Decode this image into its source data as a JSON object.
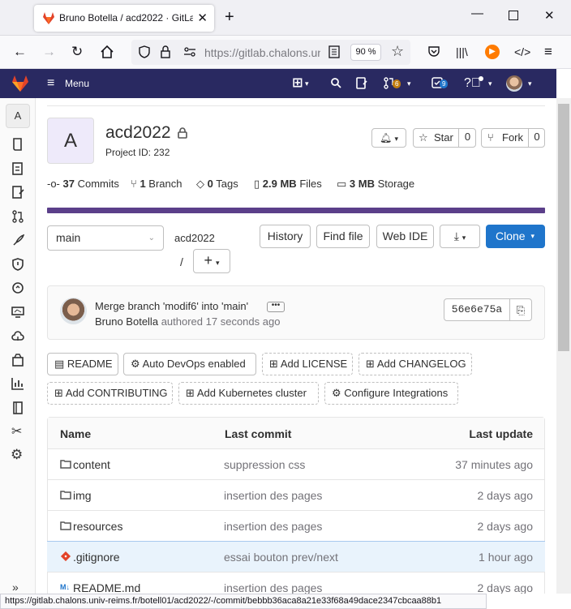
{
  "browser": {
    "tab_title": "Bruno Botella / acd2022 · GitLab",
    "url": "https://gitlab.chalons.univ-reims.fr/botell01/acd2022",
    "zoom": "90 %",
    "status_url": "https://gitlab.chalons.univ-reims.fr/botell01/acd2022/-/commit/bebbb36aca8a21e33f68a49dace2347cbcaa88b1"
  },
  "gitlab_header": {
    "menu_label": "Menu",
    "mr_count": "6",
    "todo_count": "9"
  },
  "sidebar": {
    "project_initial": "A"
  },
  "project": {
    "avatar_letter": "A",
    "name": "acd2022",
    "id_text": "Project ID: 232",
    "star_label": "Star",
    "star_count": "0",
    "fork_label": "Fork",
    "fork_count": "0"
  },
  "stats": {
    "commits_num": "37",
    "commits_label": "Commits",
    "branch_num": "1",
    "branch_label": "Branch",
    "tags_num": "0",
    "tags_label": "Tags",
    "files_num": "2.9 MB",
    "files_label": "Files",
    "storage_num": "3 MB",
    "storage_label": "Storage"
  },
  "repo_nav": {
    "branch": "main",
    "path": "acd2022",
    "separator": "/",
    "history": "History",
    "find_file": "Find file",
    "web_ide": "Web IDE",
    "clone": "Clone"
  },
  "last_commit": {
    "title": "Merge branch 'modif6' into 'main'",
    "author": "Bruno Botella",
    "authored": "authored",
    "time": "17 seconds ago",
    "sha": "56e6e75a"
  },
  "shortcuts": [
    "README",
    "Auto DevOps enabled",
    "Add LICENSE",
    "Add CHANGELOG",
    "Add CONTRIBUTING",
    "Add Kubernetes cluster",
    "Configure Integrations"
  ],
  "file_table": {
    "headers": {
      "name": "Name",
      "commit": "Last commit",
      "update": "Last update"
    },
    "rows": [
      {
        "name": "content",
        "commit": "suppression css",
        "update": "37 minutes ago"
      },
      {
        "name": "img",
        "commit": "insertion des pages",
        "update": "2 days ago"
      },
      {
        "name": "resources",
        "commit": "insertion des pages",
        "update": "2 days ago"
      },
      {
        "name": ".gitignore",
        "commit": "essai bouton prev/next",
        "update": "1 hour ago"
      },
      {
        "name": "README.md",
        "commit": "insertion des pages",
        "update": "2 days ago"
      }
    ]
  },
  "colors": {
    "gitlab_header": "#292961",
    "progress": "#5b3f8a",
    "clone": "#1f75cb",
    "highlight": "#e9f3fc"
  }
}
